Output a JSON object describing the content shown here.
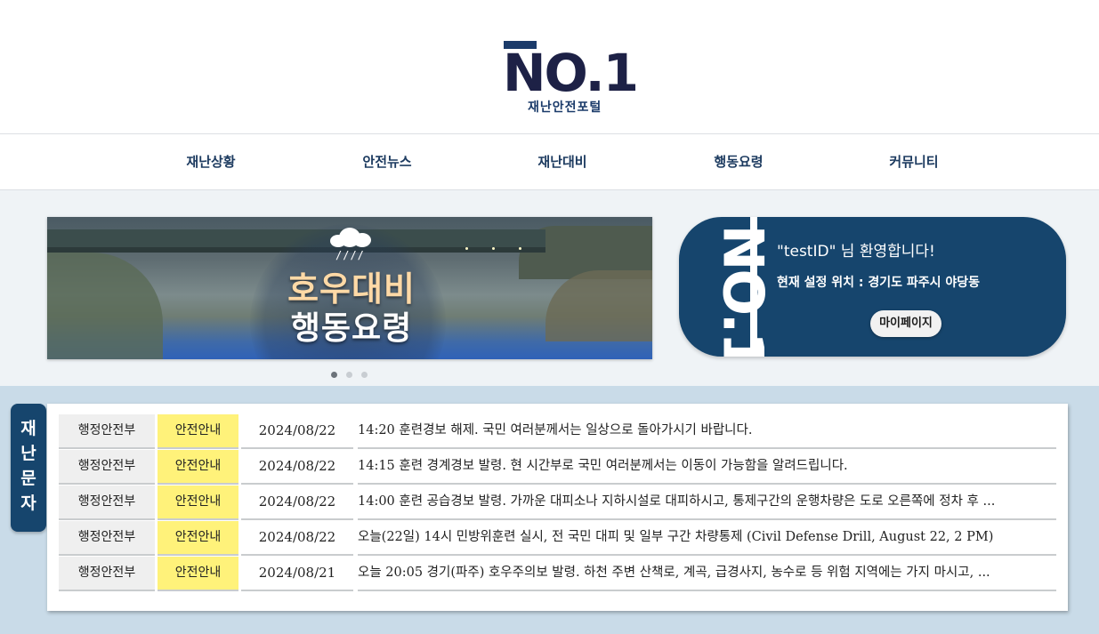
{
  "header": {
    "logo_main": "NO.1",
    "logo_sub": "재난안전포털"
  },
  "nav": {
    "items": [
      {
        "label": "재난상황"
      },
      {
        "label": "안전뉴스"
      },
      {
        "label": "재난대비"
      },
      {
        "label": "행동요령"
      },
      {
        "label": "커뮤니티"
      }
    ]
  },
  "banner": {
    "line1": "호우대비",
    "line2": "행동요령",
    "rain_glyph": "////",
    "slide_count": 3,
    "active_slide": 1
  },
  "welcome": {
    "vertical_logo": "NO.1",
    "greeting": "\"testID\" 님 환영합니다!",
    "location": "현재 설정 위치 : 경기도 파주시 야당동",
    "mypage_label": "마이페이지"
  },
  "messages": {
    "tab_label": "재\n난\n문\n자",
    "rows": [
      {
        "source": "행정안전부",
        "tag": "안전안내",
        "date": "2024/08/22",
        "text": "14:20 훈련경보 해제. 국민 여러분께서는 일상으로 돌아가시기 바랍니다."
      },
      {
        "source": "행정안전부",
        "tag": "안전안내",
        "date": "2024/08/22",
        "text": "14:15 훈련 경계경보 발령. 현 시간부로 국민 여러분께서는 이동이 가능함을 알려드립니다."
      },
      {
        "source": "행정안전부",
        "tag": "안전안내",
        "date": "2024/08/22",
        "text": "14:00 훈련 공습경보 발령. 가까운 대피소나 지하시설로 대피하시고, 통제구간의 운행차량은 도로 오른쪽에 정차 후 ..."
      },
      {
        "source": "행정안전부",
        "tag": "안전안내",
        "date": "2024/08/22",
        "text": "오늘(22일) 14시 민방위훈련 실시, 전 국민 대피 및 일부 구간 차량통제 (Civil Defense Drill, August 22, 2 PM)"
      },
      {
        "source": "행정안전부",
        "tag": "안전안내",
        "date": "2024/08/21",
        "text": "오늘 20:05 경기(파주) 호우주의보 발령. 하천 주변 산책로, 계곡, 급경사지, 농수로 등 위험 지역에는 가지 마시고, ..."
      }
    ]
  },
  "colors": {
    "brand_navy": "#16456d",
    "logo_dark": "#1d2146",
    "tag_yellow": "#fff27a",
    "section_bg": "#c9dbe8"
  }
}
